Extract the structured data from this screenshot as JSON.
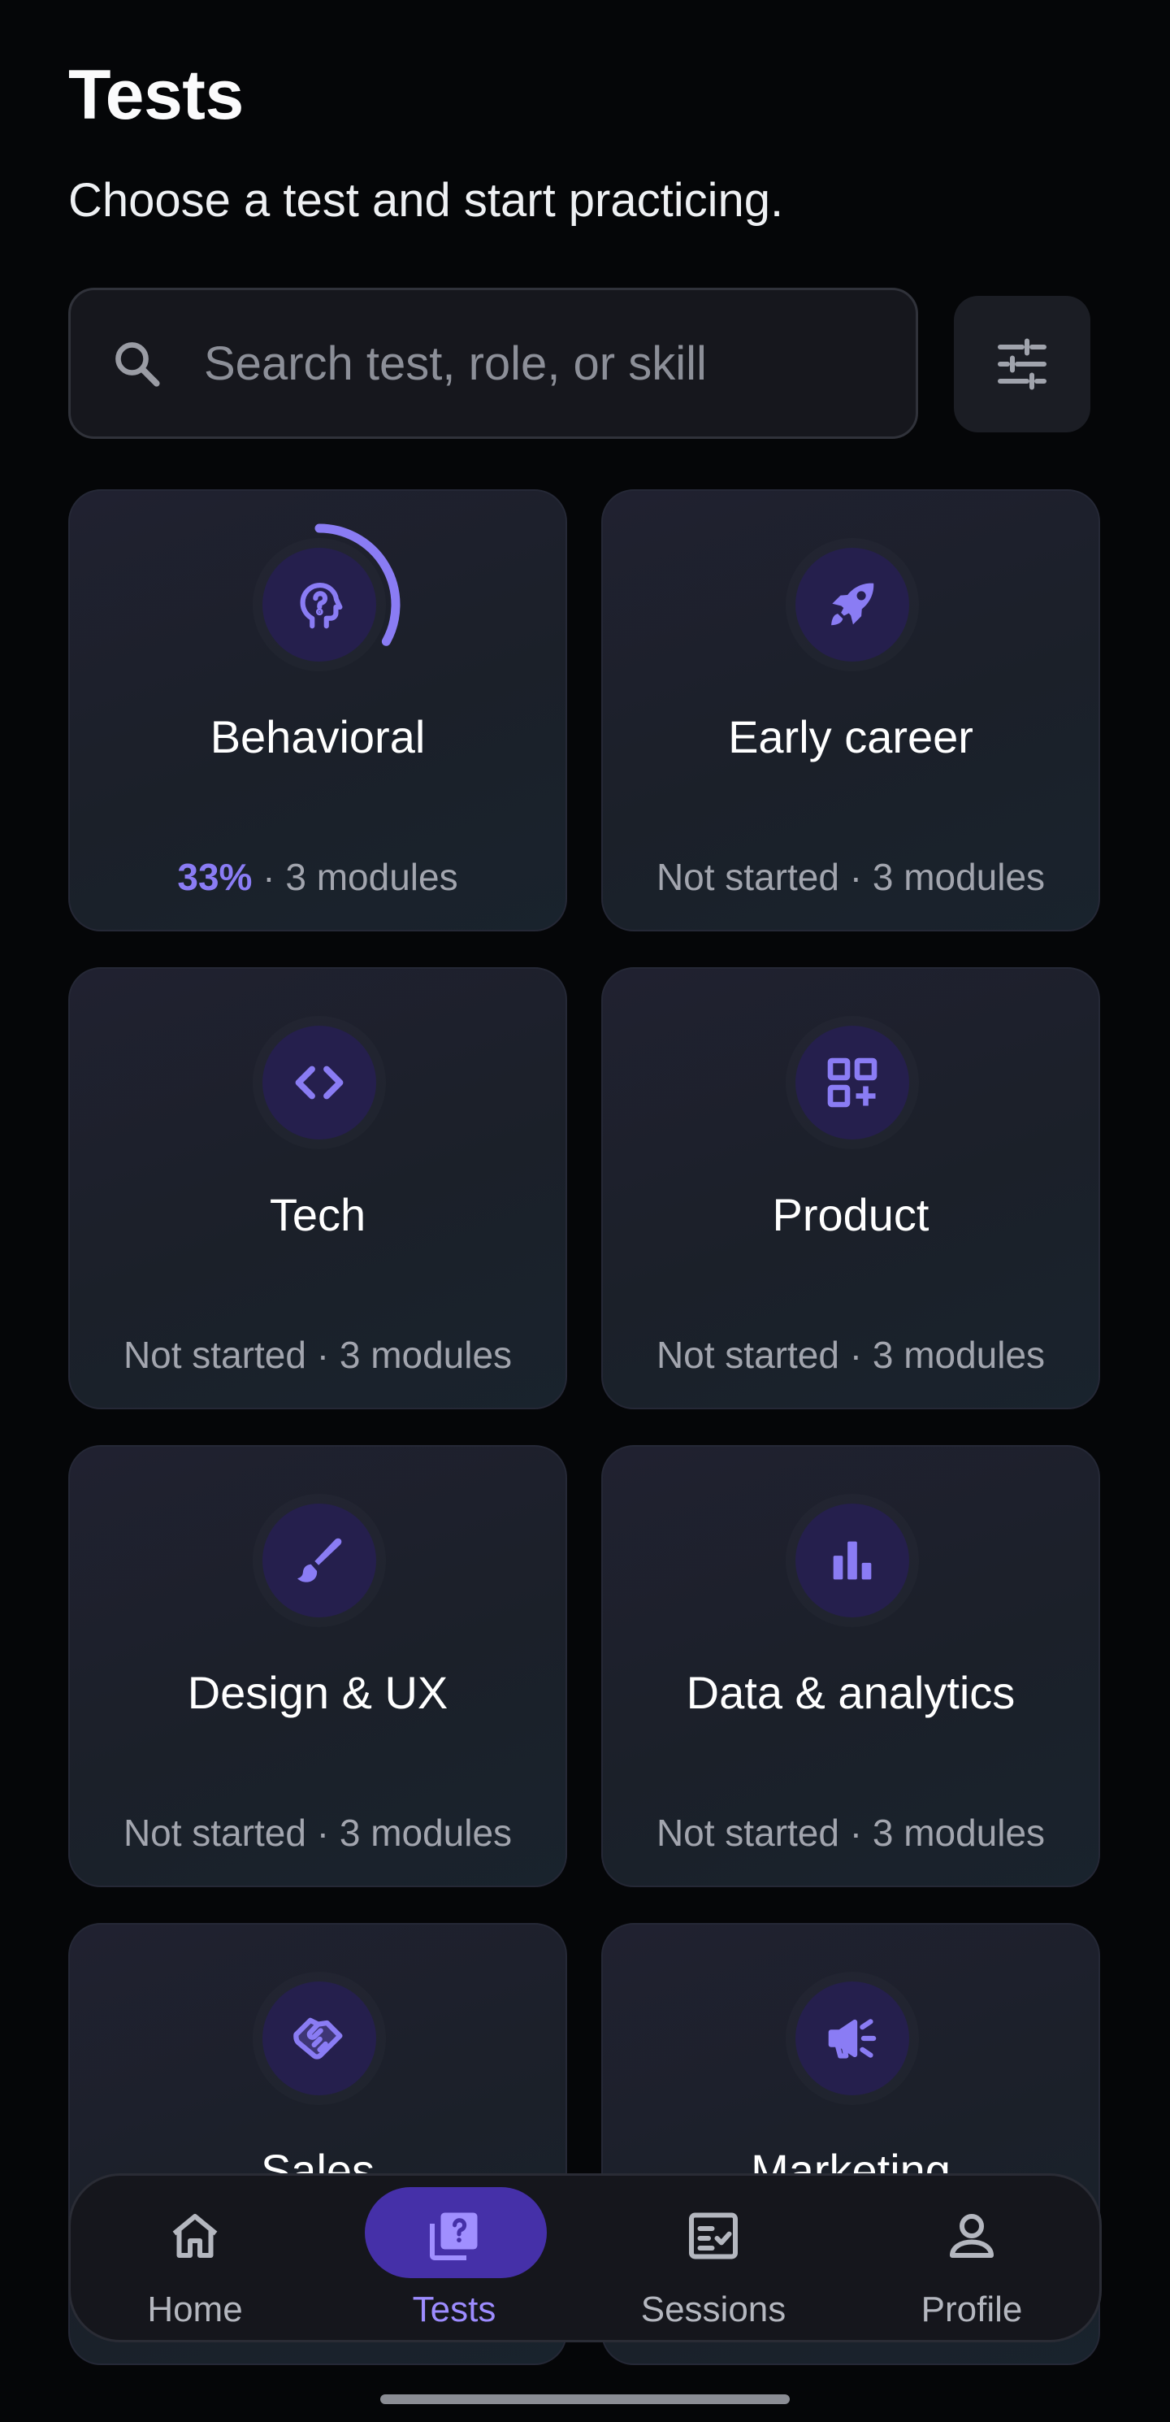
{
  "header": {
    "title": "Tests",
    "subtitle": "Choose a test and start practicing."
  },
  "search": {
    "placeholder": "Search test, role, or skill",
    "icon": "search-icon"
  },
  "filter": {
    "icon": "sliders-icon"
  },
  "cards": [
    {
      "name": "Behavioral",
      "icon": "head-question-icon",
      "progress_percent": "33%",
      "progress": 0.33,
      "meta": "3 modules"
    },
    {
      "name": "Early career",
      "icon": "rocket-icon",
      "status": "Not started",
      "meta": "3 modules"
    },
    {
      "name": "Tech",
      "icon": "code-icon",
      "status": "Not started",
      "meta": "3 modules"
    },
    {
      "name": "Product",
      "icon": "grid-plus-icon",
      "status": "Not started",
      "meta": "3 modules"
    },
    {
      "name": "Design & UX",
      "icon": "brush-icon",
      "status": "Not started",
      "meta": "3 modules"
    },
    {
      "name": "Data & analytics",
      "icon": "bar-chart-icon",
      "status": "Not started",
      "meta": "3 modules"
    },
    {
      "name": "Sales",
      "icon": "handshake-icon"
    },
    {
      "name": "Marketing",
      "icon": "megaphone-icon"
    }
  ],
  "separator": " · ",
  "nav": [
    {
      "label": "Home",
      "icon": "home-icon",
      "active": false
    },
    {
      "label": "Tests",
      "icon": "quiz-icon",
      "active": true
    },
    {
      "label": "Sessions",
      "icon": "checklist-icon",
      "active": false
    },
    {
      "label": "Profile",
      "icon": "person-icon",
      "active": false
    }
  ],
  "colors": {
    "background": "#050608",
    "accent": "#8a7cf4",
    "accent_active_pill": "#4530a8",
    "icon_circle": "#251f4d"
  }
}
